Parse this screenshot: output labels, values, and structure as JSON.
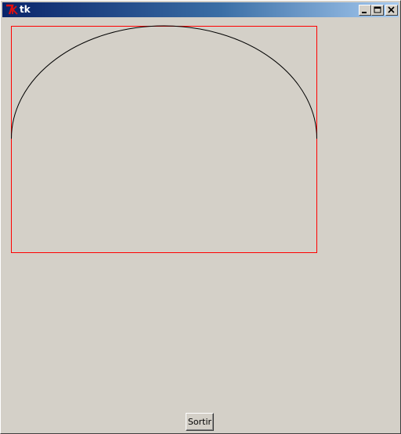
{
  "window": {
    "title": "tk",
    "logo_glyph": "7k",
    "controls": {
      "minimize": "minimize-icon",
      "maximize": "maximize-icon",
      "close": "close-icon"
    }
  },
  "canvas": {
    "rectangle_color": "#ff0000",
    "arc_color": "#000000",
    "background": "#d4d0c8"
  },
  "buttons": {
    "quit_label": "Sortir"
  }
}
